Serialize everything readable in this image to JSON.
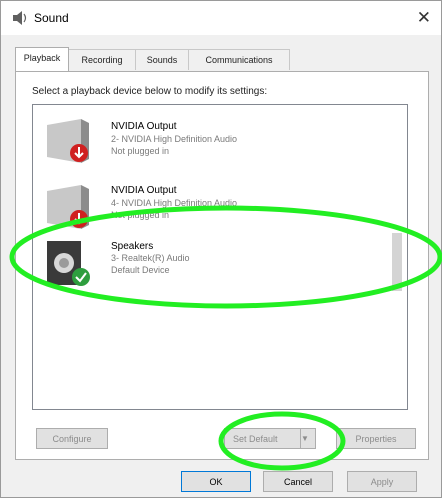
{
  "window": {
    "title": "Sound",
    "close_glyph": "✕"
  },
  "tabs": [
    {
      "label": "Playback"
    },
    {
      "label": "Recording"
    },
    {
      "label": "Sounds"
    },
    {
      "label": "Communications"
    }
  ],
  "instruction": "Select a playback device below to modify its settings:",
  "devices": [
    {
      "name": "NVIDIA Output",
      "detail": "2- NVIDIA High Definition Audio",
      "status": "Not plugged in",
      "icon": "speaker-icon",
      "badge": "red-down-arrow"
    },
    {
      "name": "NVIDIA Output",
      "detail": "4- NVIDIA High Definition Audio",
      "status": "Not plugged in",
      "icon": "speaker-icon",
      "badge": "red-down-arrow"
    },
    {
      "name": "Speakers",
      "detail": "3- Realtek(R) Audio",
      "status": "Default Device",
      "icon": "speaker-icon",
      "badge": "green-check"
    }
  ],
  "buttons": {
    "configure": "Configure",
    "set_default": "Set Default",
    "set_default_arrow": "▼",
    "properties": "Properties",
    "ok": "OK",
    "cancel": "Cancel",
    "apply": "Apply"
  },
  "annotations": {
    "color": "#22ee22"
  }
}
